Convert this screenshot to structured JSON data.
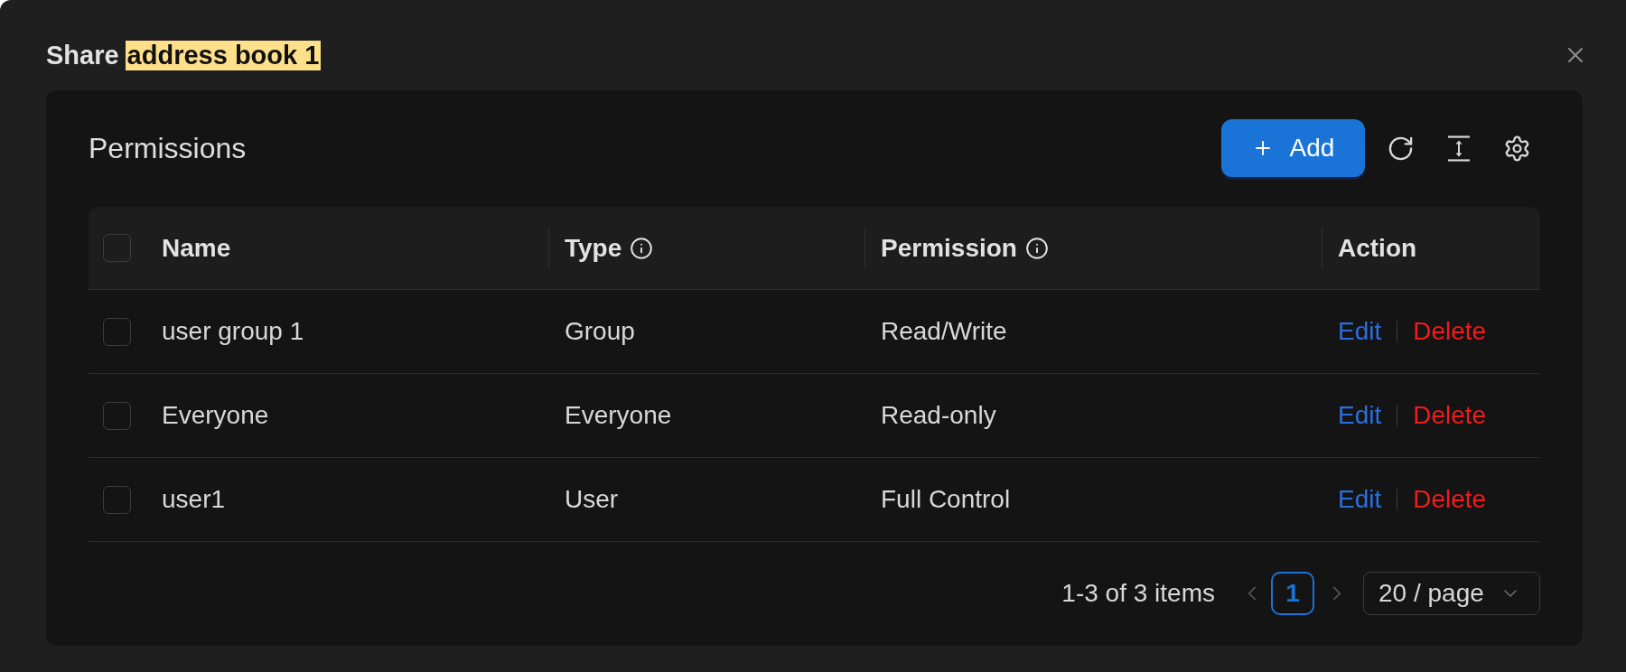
{
  "dialog": {
    "title": "Share",
    "title_highlight": "address book 1"
  },
  "panel": {
    "title": "Permissions",
    "add_button": "Add"
  },
  "table": {
    "select_all": {
      "checked": false
    },
    "columns": [
      {
        "label": "Name",
        "kind": "plain"
      },
      {
        "label": "Type",
        "kind": "info"
      },
      {
        "label": "Permission",
        "kind": "info"
      },
      {
        "label": "Action",
        "kind": "plain"
      }
    ],
    "rows": [
      {
        "checked": false,
        "name": "user group 1",
        "type": "Group",
        "permission": "Read/Write",
        "actions": [
          {
            "label": "Edit",
            "kind": "edit"
          },
          {
            "label": "Delete",
            "kind": "danger"
          }
        ]
      },
      {
        "checked": false,
        "name": "Everyone",
        "type": "Everyone",
        "permission": "Read-only",
        "actions": [
          {
            "label": "Edit",
            "kind": "edit"
          },
          {
            "label": "Delete",
            "kind": "danger"
          }
        ]
      },
      {
        "checked": false,
        "name": "user1",
        "type": "User",
        "permission": "Full Control",
        "actions": [
          {
            "label": "Edit",
            "kind": "edit"
          },
          {
            "label": "Delete",
            "kind": "danger"
          }
        ]
      }
    ]
  },
  "pagination": {
    "summary": "1-3 of 3 items",
    "prev": {
      "disabled": true
    },
    "pages": [
      {
        "label": "1",
        "selected": true
      }
    ],
    "next": {
      "disabled": true
    },
    "page_size": "20 / page"
  }
}
